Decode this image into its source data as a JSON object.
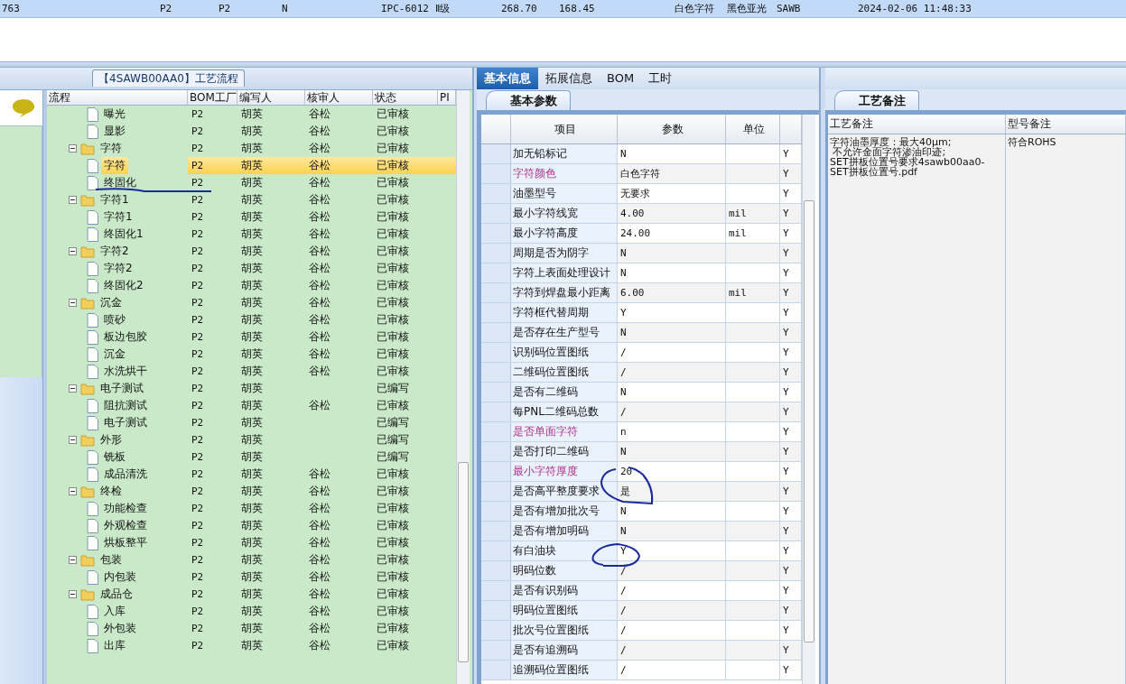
{
  "top_row": {
    "selected": true,
    "cells": [
      "763",
      "P2",
      "P2",
      "N",
      "IPC-6012 Ⅱ级",
      "268.70",
      "168.45",
      "白色字符",
      "黑色亚光",
      "SAWB",
      "2024-02-06 11:48:33"
    ]
  },
  "flow_panel": {
    "title": "【4SAWB00AA0】工艺流程",
    "columns": [
      "流程",
      "BOM工厂",
      "编写人",
      "核审人",
      "状态",
      "PI"
    ],
    "tree": [
      {
        "kind": "file",
        "label": "曝光",
        "bom": "P2",
        "writer": "胡英",
        "reviewer": "谷松",
        "status": "已审核",
        "selected": false
      },
      {
        "kind": "file",
        "label": "显影",
        "bom": "P2",
        "writer": "胡英",
        "reviewer": "谷松",
        "status": "已审核",
        "selected": false
      },
      {
        "kind": "folder",
        "label": "字符",
        "bom": "P2",
        "writer": "胡英",
        "reviewer": "谷松",
        "status": "已审核",
        "selected": false,
        "expanded": true,
        "children": [
          {
            "kind": "file",
            "label": "字符",
            "bom": "P2",
            "writer": "胡英",
            "reviewer": "谷松",
            "status": "已审核",
            "selected": true
          },
          {
            "kind": "file",
            "label": "终固化",
            "bom": "P2",
            "writer": "胡英",
            "reviewer": "谷松",
            "status": "已审核",
            "selected": false
          }
        ]
      },
      {
        "kind": "folder",
        "label": "字符1",
        "bom": "P2",
        "writer": "胡英",
        "reviewer": "谷松",
        "status": "已审核",
        "selected": false,
        "expanded": true,
        "children": [
          {
            "kind": "file",
            "label": "字符1",
            "bom": "P2",
            "writer": "胡英",
            "reviewer": "谷松",
            "status": "已审核",
            "selected": false
          },
          {
            "kind": "file",
            "label": "终固化1",
            "bom": "P2",
            "writer": "胡英",
            "reviewer": "谷松",
            "status": "已审核",
            "selected": false
          }
        ]
      },
      {
        "kind": "folder",
        "label": "字符2",
        "bom": "P2",
        "writer": "胡英",
        "reviewer": "谷松",
        "status": "已审核",
        "selected": false,
        "expanded": true,
        "children": [
          {
            "kind": "file",
            "label": "字符2",
            "bom": "P2",
            "writer": "胡英",
            "reviewer": "谷松",
            "status": "已审核",
            "selected": false
          },
          {
            "kind": "file",
            "label": "终固化2",
            "bom": "P2",
            "writer": "胡英",
            "reviewer": "谷松",
            "status": "已审核",
            "selected": false
          }
        ]
      },
      {
        "kind": "folder",
        "label": "沉金",
        "bom": "P2",
        "writer": "胡英",
        "reviewer": "谷松",
        "status": "已审核",
        "selected": false,
        "expanded": true,
        "children": [
          {
            "kind": "file",
            "label": "喷砂",
            "bom": "P2",
            "writer": "胡英",
            "reviewer": "谷松",
            "status": "已审核",
            "selected": false
          },
          {
            "kind": "file",
            "label": "板边包胶",
            "bom": "P2",
            "writer": "胡英",
            "reviewer": "谷松",
            "status": "已审核",
            "selected": false
          },
          {
            "kind": "file",
            "label": "沉金",
            "bom": "P2",
            "writer": "胡英",
            "reviewer": "谷松",
            "status": "已审核",
            "selected": false
          },
          {
            "kind": "file",
            "label": "水洗烘干",
            "bom": "P2",
            "writer": "胡英",
            "reviewer": "谷松",
            "status": "已审核",
            "selected": false
          }
        ]
      },
      {
        "kind": "folder",
        "label": "电子测试",
        "bom": "P2",
        "writer": "胡英",
        "status": "已编写",
        "selected": false,
        "expanded": true,
        "children": [
          {
            "kind": "file",
            "label": "阻抗测试",
            "bom": "P2",
            "writer": "胡英",
            "reviewer": "谷松",
            "status": "已审核",
            "selected": false
          },
          {
            "kind": "file",
            "label": "电子测试",
            "bom": "P2",
            "writer": "胡英",
            "status": "已编写",
            "selected": false
          }
        ]
      },
      {
        "kind": "folder",
        "label": "外形",
        "bom": "P2",
        "writer": "胡英",
        "status": "已编写",
        "selected": false,
        "expanded": true,
        "children": [
          {
            "kind": "file",
            "label": "铣板",
            "bom": "P2",
            "writer": "胡英",
            "status": "已编写",
            "selected": false
          },
          {
            "kind": "file",
            "label": "成品清洗",
            "bom": "P2",
            "writer": "胡英",
            "reviewer": "谷松",
            "status": "已审核",
            "selected": false
          }
        ]
      },
      {
        "kind": "folder",
        "label": "终检",
        "bom": "P2",
        "writer": "胡英",
        "reviewer": "谷松",
        "status": "已审核",
        "selected": false,
        "expanded": true,
        "children": [
          {
            "kind": "file",
            "label": "功能检查",
            "bom": "P2",
            "writer": "胡英",
            "reviewer": "谷松",
            "status": "已审核",
            "selected": false
          },
          {
            "kind": "file",
            "label": "外观检查",
            "bom": "P2",
            "writer": "胡英",
            "reviewer": "谷松",
            "status": "已审核",
            "selected": false
          },
          {
            "kind": "file",
            "label": "烘板整平",
            "bom": "P2",
            "writer": "胡英",
            "reviewer": "谷松",
            "status": "已审核",
            "selected": false
          }
        ]
      },
      {
        "kind": "folder",
        "label": "包装",
        "bom": "P2",
        "writer": "胡英",
        "reviewer": "谷松",
        "status": "已审核",
        "selected": false,
        "expanded": true,
        "children": [
          {
            "kind": "file",
            "label": "内包装",
            "bom": "P2",
            "writer": "胡英",
            "reviewer": "谷松",
            "status": "已审核",
            "selected": false
          }
        ]
      },
      {
        "kind": "folder",
        "label": "成品仓",
        "bom": "P2",
        "writer": "胡英",
        "reviewer": "谷松",
        "status": "已审核",
        "selected": false,
        "expanded": true,
        "children": [
          {
            "kind": "file",
            "label": "入库",
            "bom": "P2",
            "writer": "胡英",
            "reviewer": "谷松",
            "status": "已审核",
            "selected": false
          },
          {
            "kind": "file",
            "label": "外包装",
            "bom": "P2",
            "writer": "胡英",
            "reviewer": "谷松",
            "status": "已审核",
            "selected": false
          },
          {
            "kind": "file",
            "label": "出库",
            "bom": "P2",
            "writer": "胡英",
            "reviewer": "谷松",
            "status": "已审核",
            "selected": false
          }
        ]
      }
    ]
  },
  "info_panel": {
    "tabs": [
      {
        "label": "基本信息",
        "selected": true
      },
      {
        "label": "拓展信息",
        "selected": false
      },
      {
        "label": "BOM",
        "selected": false
      },
      {
        "label": "工时",
        "selected": false
      }
    ],
    "subtab": {
      "label": "基本参数",
      "selected": true
    },
    "columns": [
      "项目",
      "参数",
      "单位"
    ],
    "rows": [
      {
        "item": "加无铅标记",
        "value": "N",
        "flag": "Y",
        "emphasized": false
      },
      {
        "item": "字符颜色",
        "value": "白色字符",
        "flag": "Y",
        "emphasized": true
      },
      {
        "item": "油墨型号",
        "value": "无要求",
        "flag": "Y",
        "emphasized": false
      },
      {
        "item": "最小字符线宽",
        "value": "4.00",
        "unit": "mil",
        "flag": "Y",
        "emphasized": false
      },
      {
        "item": "最小字符高度",
        "value": "24.00",
        "unit": "mil",
        "flag": "Y",
        "emphasized": false
      },
      {
        "item": "周期是否为阴字",
        "value": "N",
        "flag": "Y",
        "emphasized": false
      },
      {
        "item": "字符上表面处理设计",
        "value": "N",
        "flag": "Y",
        "emphasized": false
      },
      {
        "item": "字符到焊盘最小距离",
        "value": "6.00",
        "unit": "mil",
        "flag": "Y",
        "emphasized": false
      },
      {
        "item": "字符框代替周期",
        "value": "Y",
        "flag": "Y",
        "emphasized": false
      },
      {
        "item": "是否存在生产型号",
        "value": "N",
        "flag": "Y",
        "emphasized": false
      },
      {
        "item": "识别码位置图纸",
        "value": "/",
        "flag": "Y",
        "emphasized": false
      },
      {
        "item": "二维码位置图纸",
        "value": "/",
        "flag": "Y",
        "emphasized": false
      },
      {
        "item": "是否有二维码",
        "value": "N",
        "flag": "Y",
        "emphasized": false
      },
      {
        "item": "每PNL二维码总数",
        "value": "/",
        "flag": "Y",
        "emphasized": false
      },
      {
        "item": "是否单面字符",
        "value": "n",
        "flag": "Y",
        "emphasized": true
      },
      {
        "item": "是否打印二维码",
        "value": "N",
        "flag": "Y",
        "emphasized": false
      },
      {
        "item": "最小字符厚度",
        "value": "20",
        "flag": "Y",
        "emphasized": true
      },
      {
        "item": "是否高平整度要求",
        "value": "是",
        "flag": "Y",
        "emphasized": false
      },
      {
        "item": "是否有增加批次号",
        "value": "N",
        "flag": "Y",
        "emphasized": false
      },
      {
        "item": "是否有增加明码",
        "value": "N",
        "flag": "Y",
        "emphasized": false
      },
      {
        "item": "有白油块",
        "value": "Y",
        "flag": "Y",
        "emphasized": false
      },
      {
        "item": "明码位数",
        "value": "/",
        "flag": "Y",
        "emphasized": false
      },
      {
        "item": "是否有识别码",
        "value": "/",
        "flag": "Y",
        "emphasized": false
      },
      {
        "item": "明码位置图纸",
        "value": "/",
        "flag": "Y",
        "emphasized": false
      },
      {
        "item": "批次号位置图纸",
        "value": "/",
        "flag": "Y",
        "emphasized": false
      },
      {
        "item": "是否有追溯码",
        "value": "/",
        "flag": "Y",
        "emphasized": false
      },
      {
        "item": "追溯码位置图纸",
        "value": "/",
        "flag": "Y",
        "emphasized": false
      }
    ]
  },
  "notes_panel": {
    "subtab": {
      "label": "工艺备注",
      "selected": true
    },
    "columns": [
      "工艺备注",
      "型号备注"
    ],
    "process_note": [
      "字符油墨厚度：最大40μm;",
      " 不允许金面字符渗油印迹;",
      "SET拼板位置号要求4sawb00aa0-",
      "SET拼板位置号.pdf"
    ],
    "model_note": "符合ROHS"
  }
}
